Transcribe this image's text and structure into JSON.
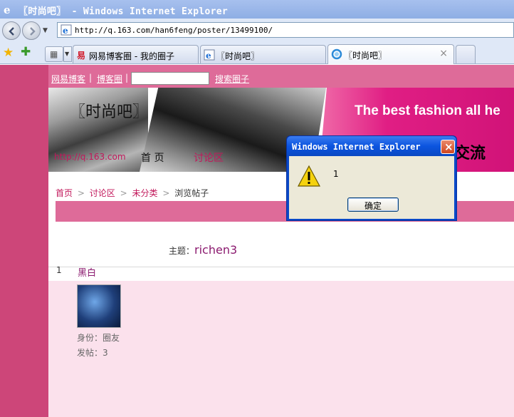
{
  "window": {
    "title": "〖时尚吧〗 - Windows Internet Explorer"
  },
  "address": {
    "url": "http://q.163.com/han6feng/poster/13499100/"
  },
  "tabs": [
    {
      "label": "网易博客圈 - 我的圈子",
      "icon": "netease-icon"
    },
    {
      "label": "〖时尚吧〗",
      "icon": "ie-page-icon"
    },
    {
      "label": "〖时尚吧〗",
      "icon": "loading-icon",
      "close": "×"
    }
  ],
  "page": {
    "topnav": {
      "link1": "网易博客",
      "link2": "博客圈",
      "link3": "搜索圈子",
      "sep": "|"
    },
    "banner": {
      "site_name": "〖时尚吧〗",
      "slogan": "The best fashion all he",
      "home_url": "http://q.163.com",
      "nav_home": "首 页",
      "nav_forum": "讨论区",
      "tagline": "交流"
    },
    "breadcrumb": {
      "home": "首页",
      "forum": "讨论区",
      "category": "未分类",
      "current": "浏览帖子",
      "sep": ">"
    },
    "subject": {
      "label": "主题：",
      "value": "richen3"
    },
    "post": {
      "number": "1",
      "title": "黑白",
      "identity": "身份：圈友",
      "posts": "发帖：3"
    }
  },
  "dialog": {
    "title": "Windows Internet Explorer",
    "message": "1",
    "ok": "确定",
    "close": "×"
  },
  "colors": {
    "accent_pink": "#de6b99",
    "sidebar": "#cd4679",
    "post_bg": "#fbe1ec",
    "link": "#c2185b"
  }
}
